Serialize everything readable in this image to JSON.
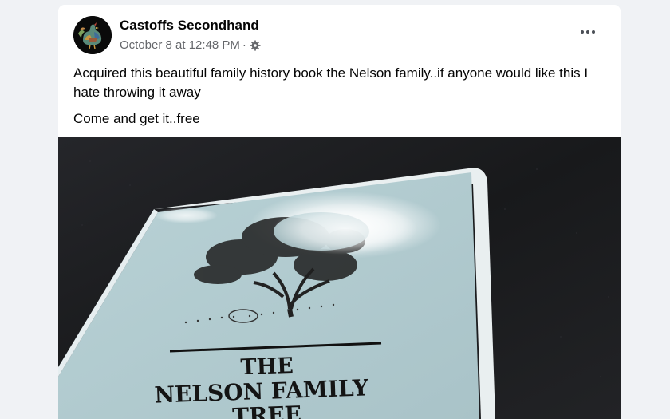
{
  "post": {
    "author": "Castoffs Secondhand",
    "timestamp": "October 8 at 12:48 PM",
    "separator": "·",
    "privacy_icon": "gear-icon",
    "more_icon": "more-options-icon",
    "paragraphs": [
      "Acquired this beautiful family history book the Nelson family..if anyone would like this I hate throwing it away",
      "Come and get it..free"
    ],
    "photo": {
      "book_title_line1": "THE",
      "book_title_line2": "NELSON FAMILY",
      "book_title_line3": "TREE"
    }
  },
  "colors": {
    "text": "#050505",
    "secondary": "#65676b",
    "book_cover": "#b7cfd3",
    "countertop": "#1b1c1e"
  }
}
